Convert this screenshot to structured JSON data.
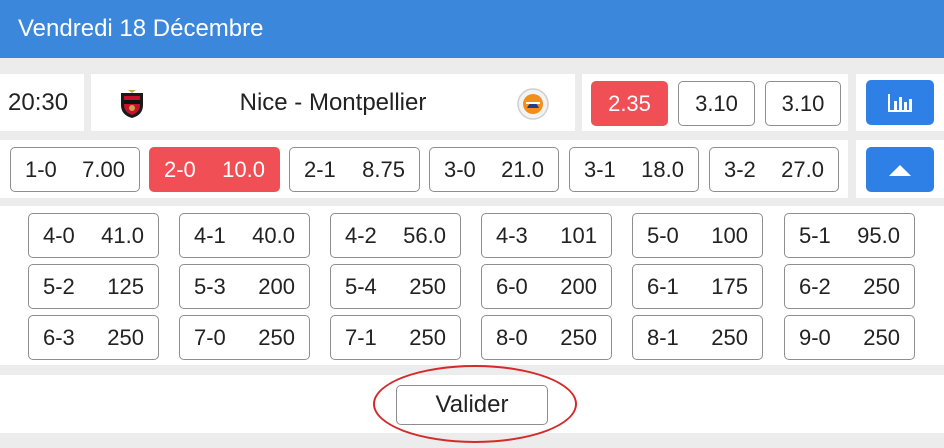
{
  "header": {
    "title": "Vendredi 18 Décembre"
  },
  "match": {
    "time": "20:30",
    "name": "Nice - Montpellier",
    "home_logo_icon": "ogc-nice-crest-icon",
    "away_logo_icon": "montpellier-hsc-crest-icon",
    "odds": [
      {
        "value": "2.35",
        "selected": true
      },
      {
        "value": "3.10",
        "selected": false
      },
      {
        "value": "3.10",
        "selected": false
      }
    ],
    "stats_icon": "bar-chart-icon",
    "toggle_icon": "chevron-up-icon"
  },
  "top_scores": [
    {
      "score": "1-0",
      "odd": "7.00",
      "selected": false
    },
    {
      "score": "2-0",
      "odd": "10.0",
      "selected": true
    },
    {
      "score": "2-1",
      "odd": "8.75",
      "selected": false
    },
    {
      "score": "3-0",
      "odd": "21.0",
      "selected": false
    },
    {
      "score": "3-1",
      "odd": "18.0",
      "selected": false
    },
    {
      "score": "3-2",
      "odd": "27.0",
      "selected": false
    }
  ],
  "more_scores": [
    {
      "score": "4-0",
      "odd": "41.0"
    },
    {
      "score": "4-1",
      "odd": "40.0"
    },
    {
      "score": "4-2",
      "odd": "56.0"
    },
    {
      "score": "4-3",
      "odd": "101"
    },
    {
      "score": "5-0",
      "odd": "100"
    },
    {
      "score": "5-1",
      "odd": "95.0"
    },
    {
      "score": "5-2",
      "odd": "125"
    },
    {
      "score": "5-3",
      "odd": "200"
    },
    {
      "score": "5-4",
      "odd": "250"
    },
    {
      "score": "6-0",
      "odd": "200"
    },
    {
      "score": "6-1",
      "odd": "175"
    },
    {
      "score": "6-2",
      "odd": "250"
    },
    {
      "score": "6-3",
      "odd": "250"
    },
    {
      "score": "7-0",
      "odd": "250"
    },
    {
      "score": "7-1",
      "odd": "250"
    },
    {
      "score": "8-0",
      "odd": "250"
    },
    {
      "score": "8-1",
      "odd": "250"
    },
    {
      "score": "9-0",
      "odd": "250"
    }
  ],
  "footer": {
    "submit_label": "Valider"
  },
  "colors": {
    "header": "#3b87dc",
    "selected": "#ef4f55",
    "action": "#2f80e6",
    "annotation": "#d42a2a"
  }
}
